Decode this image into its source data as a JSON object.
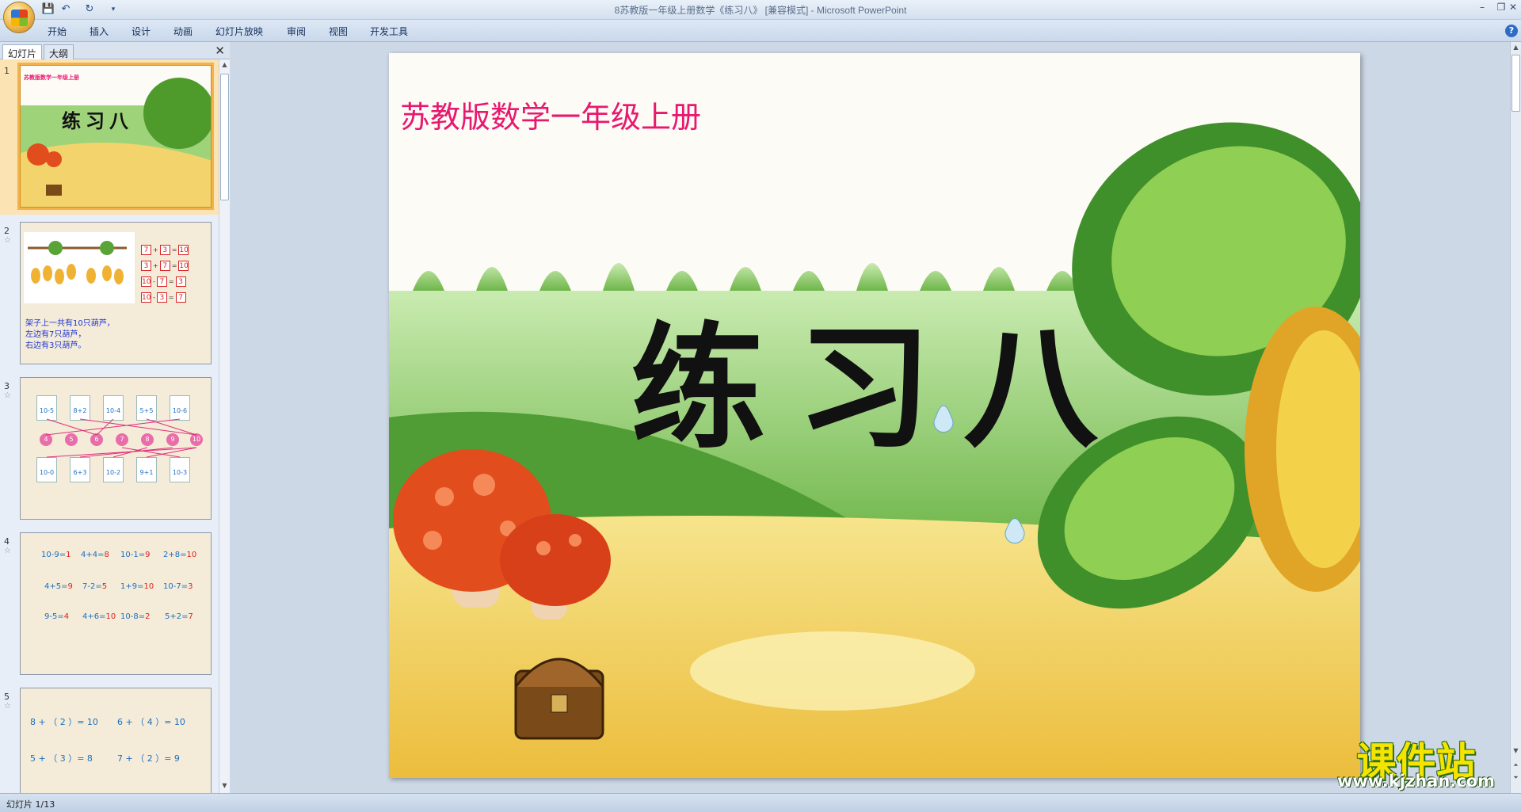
{
  "window": {
    "title": "8苏教版一年级上册数学《练习八》 [兼容模式] - Microsoft PowerPoint"
  },
  "quick_access": {
    "save_icon": "save-icon",
    "undo_icon": "undo-icon",
    "redo_icon": "redo-icon",
    "customize_icon": "dropdown-icon"
  },
  "ribbon": {
    "tabs": [
      "开始",
      "插入",
      "设计",
      "动画",
      "幻灯片放映",
      "审阅",
      "视图",
      "开发工具"
    ]
  },
  "left_pane": {
    "tab_slides": "幻灯片",
    "tab_outline": "大纲",
    "close": "✕",
    "thumbnails": [
      {
        "num": "1",
        "header": "苏教版数学一年级上册",
        "title": "练习八"
      },
      {
        "num": "2",
        "rows": [
          [
            "7",
            "+",
            "3",
            "=",
            "10"
          ],
          [
            "3",
            "+",
            "7",
            "=",
            "10"
          ],
          [
            "10",
            "-",
            "7",
            "=",
            "3"
          ],
          [
            "10",
            "-",
            "3",
            "=",
            "7"
          ]
        ],
        "caption": [
          "架子上一共有10只葫芦，",
          "左边有7只葫芦，",
          "右边有3只葫芦。"
        ]
      },
      {
        "num": "3",
        "top_cards": [
          "10-5",
          "8+2",
          "10-4",
          "5+5",
          "10-6"
        ],
        "flowers": [
          "4",
          "5",
          "6",
          "7",
          "8",
          "9",
          "10"
        ],
        "bottom_cards": [
          "10-0",
          "6+3",
          "10-2",
          "9+1",
          "10-3"
        ]
      },
      {
        "num": "4",
        "rows": [
          [
            [
              "10-9=",
              "1"
            ],
            [
              "4+4=",
              "8"
            ],
            [
              "10-1=",
              "9"
            ],
            [
              "2+8=",
              "10"
            ]
          ],
          [
            [
              "4+5=",
              "9"
            ],
            [
              "7-2=",
              "5"
            ],
            [
              "1+9=",
              "10"
            ],
            [
              "10-7=",
              "3"
            ]
          ],
          [
            [
              "9-5=",
              "4"
            ],
            [
              "4+6=",
              "10"
            ],
            [
              "10-8=",
              "2"
            ],
            [
              "5+2=",
              "7"
            ]
          ]
        ]
      },
      {
        "num": "5",
        "rows": [
          [
            "8 + （ 2 ）= 10",
            "6 + （ 4 ）= 10"
          ],
          [
            "5 + （ 3 ）= 8",
            "7 + （ 2 ）= 9"
          ]
        ]
      }
    ]
  },
  "slide": {
    "subtitle": "苏教版数学一年级上册",
    "title": "练习八"
  },
  "status": {
    "slide_counter": "幻灯片 1/13"
  },
  "watermark": {
    "title": "课件站",
    "url": "www.kjzhan.com"
  },
  "colors": {
    "subtitle": "#e8186e",
    "selection": "#f3b24a"
  }
}
